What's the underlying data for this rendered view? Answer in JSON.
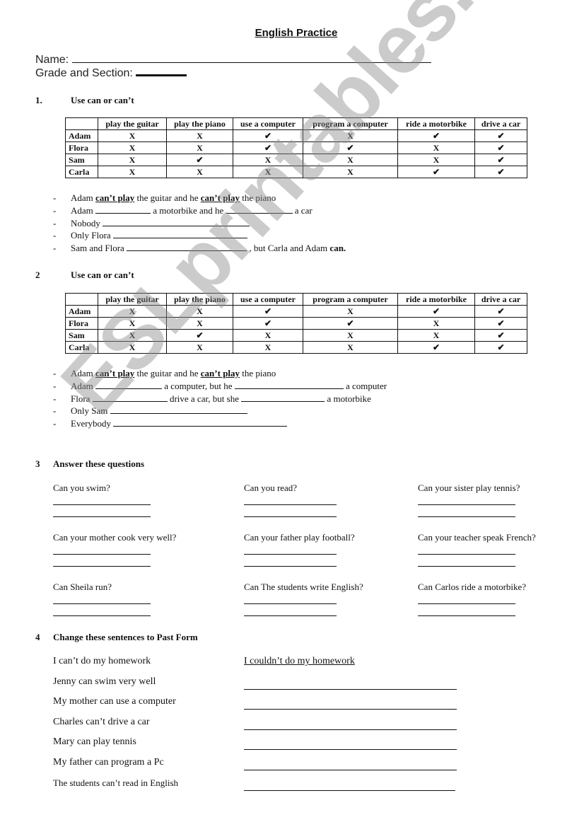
{
  "title": "English Practice",
  "header": {
    "name_label": "Name:",
    "grade_label": "Grade and Section:"
  },
  "watermark": "ESLprintables.com",
  "section1": {
    "number": "1.",
    "title": "Use can or can’t",
    "table": {
      "columns": [
        "",
        "play the guitar",
        "play the piano",
        "use a computer",
        "program a computer",
        "ride a motorbike",
        "drive a car"
      ],
      "rows": [
        {
          "name": "Adam",
          "cells": [
            "X",
            "X",
            "✔",
            "X",
            "✔",
            "✔"
          ]
        },
        {
          "name": "Flora",
          "cells": [
            "X",
            "X",
            "✔",
            "✔",
            "X",
            "✔"
          ]
        },
        {
          "name": "Sam",
          "cells": [
            "X",
            "✔",
            "X",
            "X",
            "X",
            "✔"
          ]
        },
        {
          "name": "Carla",
          "cells": [
            "X",
            "X",
            "X",
            "X",
            "✔",
            "✔"
          ]
        }
      ]
    },
    "sentences": [
      {
        "dash": "-",
        "parts": [
          "Adam ",
          "can’t play",
          " the guitar and he ",
          "can’t play",
          " the piano"
        ]
      },
      {
        "dash": "-",
        "parts": [
          "Adam ",
          " a motorbike and he ",
          " a car"
        ]
      },
      {
        "dash": "-",
        "parts": [
          "Nobody "
        ]
      },
      {
        "dash": "-",
        "parts": [
          "Only Flora "
        ]
      },
      {
        "dash": "-",
        "parts": [
          "Sam and Flora ",
          " , but Carla and Adam ",
          "can."
        ]
      }
    ]
  },
  "section2": {
    "number": "2",
    "title": "Use can or can’t",
    "table": {
      "columns": [
        "",
        "play the guitar",
        "play the piano",
        "use a computer",
        "program a computer",
        "ride a motorbike",
        "drive a car"
      ],
      "rows": [
        {
          "name": "Adam",
          "cells": [
            "X",
            "X",
            "✔",
            "X",
            "✔",
            "✔"
          ]
        },
        {
          "name": "Flora",
          "cells": [
            "X",
            "X",
            "✔",
            "✔",
            "X",
            "✔"
          ]
        },
        {
          "name": "Sam",
          "cells": [
            "X",
            "✔",
            "X",
            "X",
            "X",
            "✔"
          ]
        },
        {
          "name": "Carla",
          "cells": [
            "X",
            "X",
            "X",
            "X",
            "✔",
            "✔"
          ]
        }
      ]
    },
    "sentences": [
      {
        "dash": "-",
        "parts": [
          "Adam ",
          "can’t play",
          " the guitar and he ",
          "can’t play",
          " the piano"
        ]
      },
      {
        "dash": "-",
        "parts": [
          "Adam ",
          " a computer, but he ",
          " a computer"
        ]
      },
      {
        "dash": "-",
        "parts": [
          "Flora ",
          " drive a car, but she ",
          " a motorbike"
        ]
      },
      {
        "dash": "-",
        "parts": [
          "Only Sam "
        ]
      },
      {
        "dash": "-",
        "parts": [
          "Everybody "
        ]
      }
    ]
  },
  "section3": {
    "number": "3",
    "title": "Answer these questions",
    "questions": [
      "Can you swim?",
      "Can you read?",
      "Can your sister play tennis?",
      "Can your mother cook very well?",
      "Can your father play football?",
      "Can your teacher speak French?",
      "Can Sheila run?",
      "Can The students write English?",
      "Can Carlos ride a motorbike?"
    ]
  },
  "section4": {
    "number": "4",
    "title": "Change these sentences  to Past Form",
    "items": [
      {
        "sentence": "I can’t do my homework",
        "answer": "I couldn’t do my homework"
      },
      {
        "sentence": "Jenny can swim very well",
        "answer": ""
      },
      {
        "sentence": "My mother can use a computer",
        "answer": ""
      },
      {
        "sentence": "Charles can’t drive a car",
        "answer": ""
      },
      {
        "sentence": "Mary can play tennis",
        "answer": ""
      },
      {
        "sentence": "My father can program a Pc",
        "answer": ""
      },
      {
        "sentence": "The students can’t  read in English",
        "answer": ""
      }
    ]
  }
}
